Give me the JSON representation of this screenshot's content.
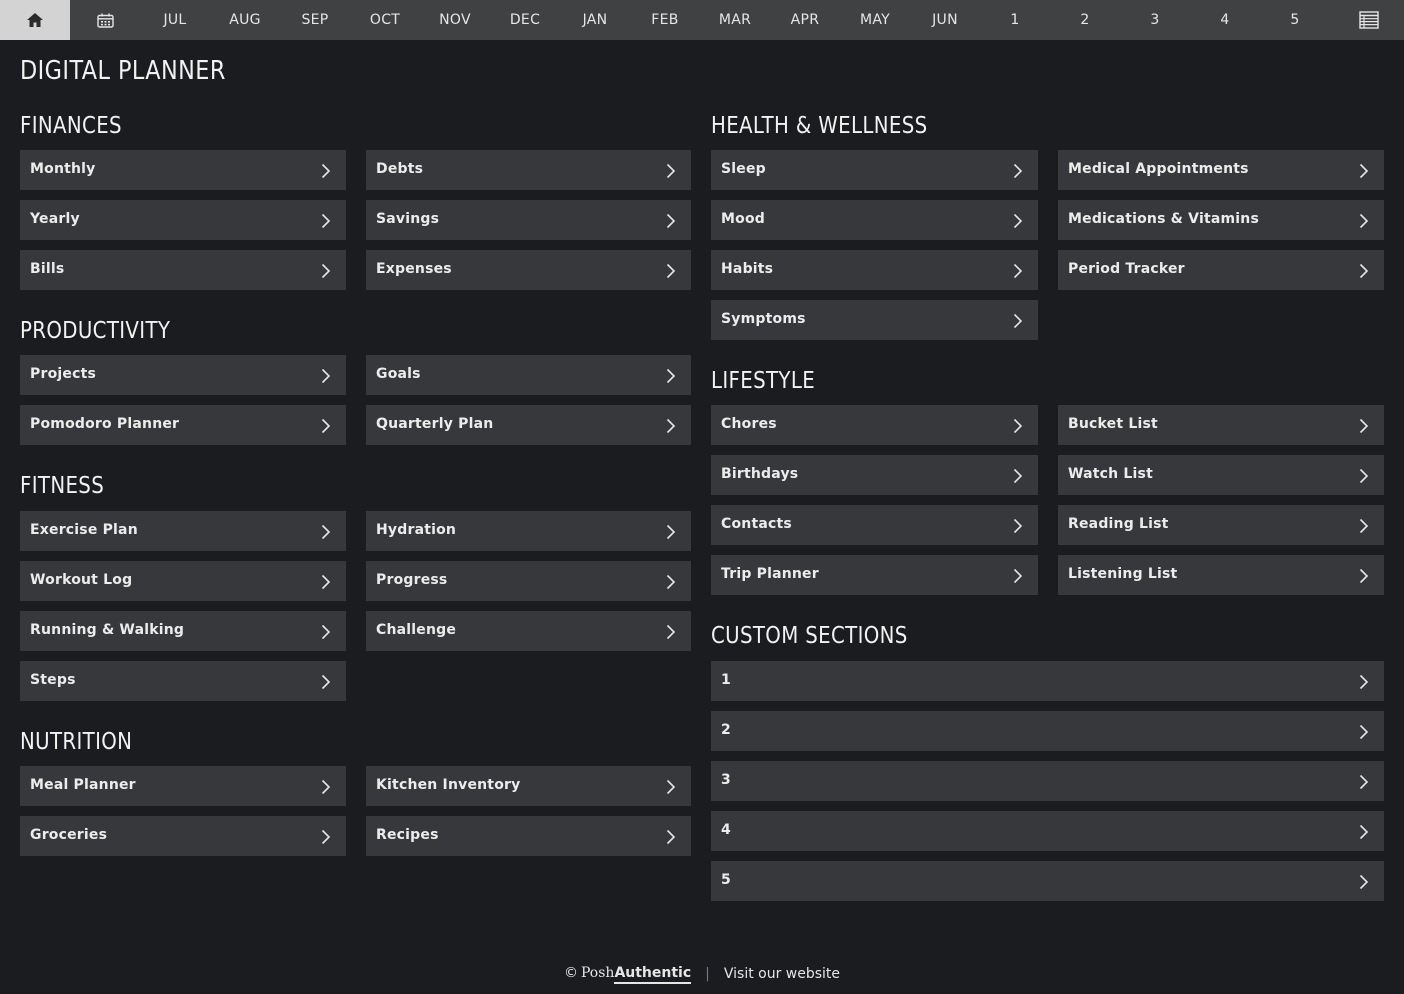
{
  "nav": {
    "home_icon": "home-icon",
    "calendar_icon": "calendar-icon",
    "items": [
      "JUL",
      "AUG",
      "SEP",
      "OCT",
      "NOV",
      "DEC",
      "JAN",
      "FEB",
      "MAR",
      "APR",
      "MAY",
      "JUN",
      "1",
      "2",
      "3",
      "4",
      "5"
    ],
    "list_icon": "list-icon"
  },
  "title": "DIGITAL PLANNER",
  "sections": {
    "finances": {
      "title": "FINANCES",
      "col1": [
        "Monthly",
        "Yearly",
        "Bills"
      ],
      "col2": [
        "Debts",
        "Savings",
        "Expenses"
      ]
    },
    "productivity": {
      "title": "PRODUCTIVITY",
      "col1": [
        "Projects",
        "Pomodoro Planner"
      ],
      "col2": [
        "Goals",
        "Quarterly Plan"
      ]
    },
    "fitness": {
      "title": "FITNESS",
      "col1": [
        "Exercise Plan",
        "Workout Log",
        "Running & Walking",
        "Steps"
      ],
      "col2": [
        "Hydration",
        "Progress",
        "Challenge"
      ]
    },
    "nutrition": {
      "title": "NUTRITION",
      "col1": [
        "Meal Planner",
        "Groceries"
      ],
      "col2": [
        "Kitchen Inventory",
        "Recipes"
      ]
    },
    "health": {
      "title": "HEALTH & WELLNESS",
      "col1": [
        "Sleep",
        "Mood",
        "Habits",
        "Symptoms"
      ],
      "col2": [
        "Medical Appointments",
        "Medications & Vitamins",
        "Period Tracker"
      ]
    },
    "lifestyle": {
      "title": "LIFESTYLE",
      "col1": [
        "Chores",
        "Birthdays",
        "Contacts",
        "Trip Planner"
      ],
      "col2": [
        "Bucket List",
        "Watch List",
        "Reading List",
        "Listening List"
      ]
    },
    "custom": {
      "title": "CUSTOM SECTIONS",
      "items": [
        "1",
        "2",
        "3",
        "4",
        "5"
      ]
    }
  },
  "footer": {
    "copyright": "©",
    "brand_part1": "Posh",
    "brand_part2": "Authentic",
    "separator": "|",
    "website_link": "Visit our website"
  },
  "colors": {
    "background": "#1b1c1f",
    "topbar": "#404143",
    "tile": "#37383b",
    "home_active": "#d3d3d3",
    "text": "#ececec"
  }
}
